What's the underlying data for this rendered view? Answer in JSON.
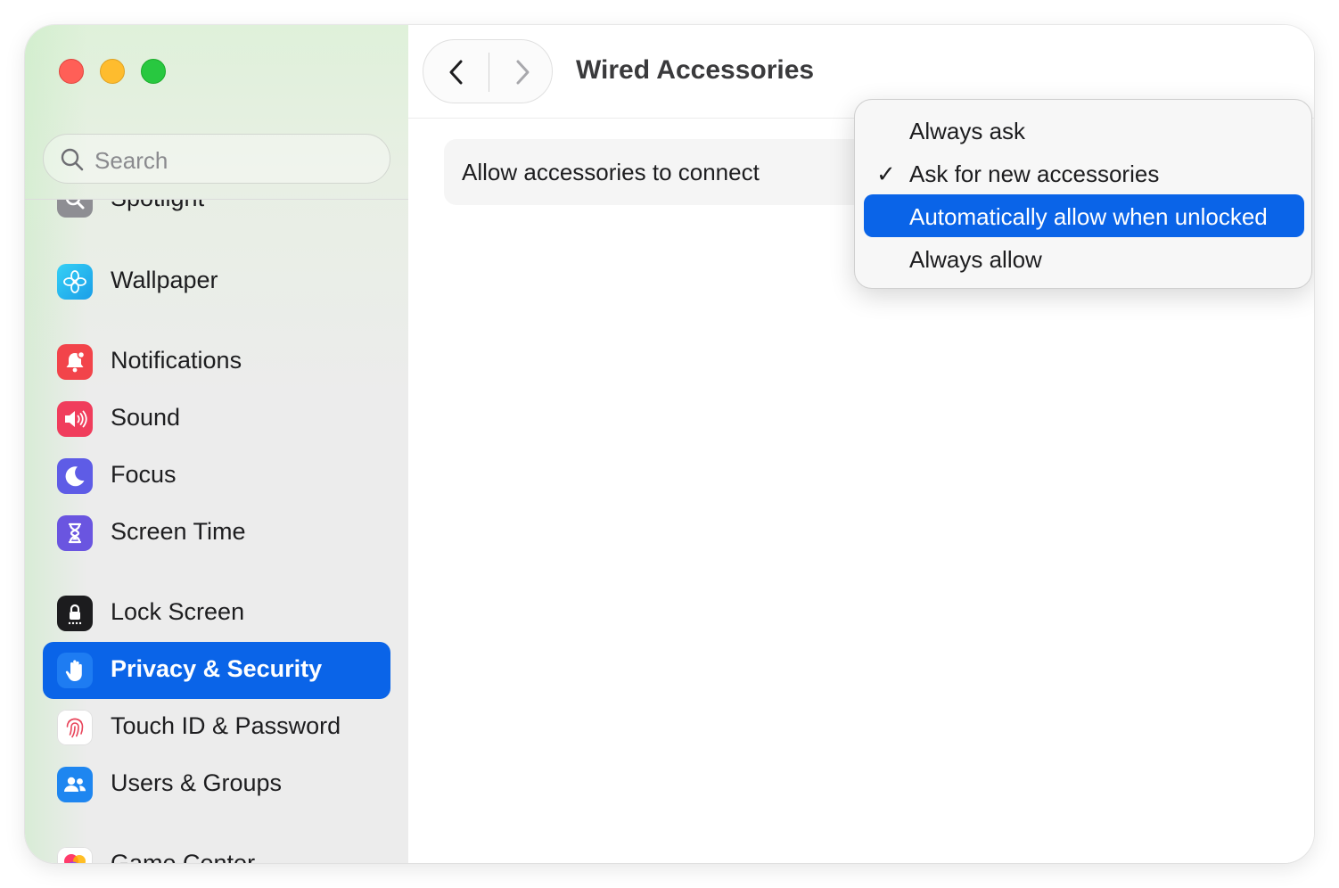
{
  "window": {
    "title": "Wired Accessories"
  },
  "search": {
    "placeholder": "Search"
  },
  "sidebar": {
    "items": [
      {
        "label": "Spotlight",
        "icon": "spotlight-icon"
      },
      {
        "label": "Wallpaper",
        "icon": "wallpaper-icon"
      },
      {
        "label": "Notifications",
        "icon": "notifications-icon"
      },
      {
        "label": "Sound",
        "icon": "sound-icon"
      },
      {
        "label": "Focus",
        "icon": "focus-icon"
      },
      {
        "label": "Screen Time",
        "icon": "screen-time-icon"
      },
      {
        "label": "Lock Screen",
        "icon": "lock-screen-icon"
      },
      {
        "label": "Privacy & Security",
        "icon": "privacy-hand-icon",
        "selected": true
      },
      {
        "label": "Touch ID & Password",
        "icon": "fingerprint-icon"
      },
      {
        "label": "Users & Groups",
        "icon": "users-icon"
      },
      {
        "label": "Game Center",
        "icon": "game-center-icon"
      }
    ]
  },
  "setting": {
    "label": "Allow accessories to connect"
  },
  "menu": {
    "options": [
      {
        "label": "Always ask",
        "checked": false,
        "highlighted": false
      },
      {
        "label": "Ask for new accessories",
        "checked": true,
        "highlighted": false
      },
      {
        "label": "Automatically allow when unlocked",
        "checked": false,
        "highlighted": true
      },
      {
        "label": "Always allow",
        "checked": false,
        "highlighted": false
      }
    ],
    "checkmark": "✓"
  },
  "colors": {
    "accent": "#0a64e8",
    "close": "#ff5f57",
    "minimize": "#febc2e",
    "zoom": "#28c840"
  }
}
